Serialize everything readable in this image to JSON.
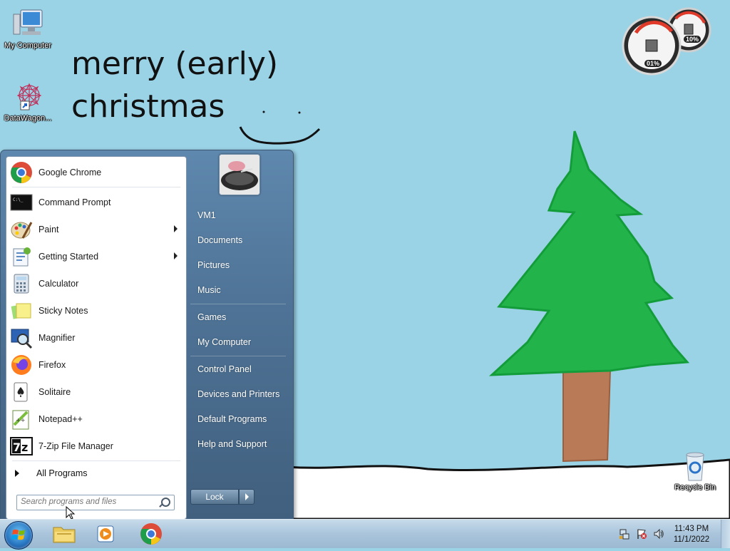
{
  "desktop": {
    "wallpaper_text_line1": "merry (early)",
    "wallpaper_text_line2": "christmas",
    "icons": [
      {
        "label": "My Computer",
        "icon": "my-computer-icon"
      },
      {
        "label": "DataWagon...",
        "icon": "datawagon-shortcut-icon"
      },
      {
        "label": "Recycle Bin",
        "icon": "recycle-bin-icon"
      }
    ]
  },
  "gadget": {
    "cpu_percent": "01%",
    "memory_percent": "10%"
  },
  "start_menu": {
    "programs": [
      {
        "label": "Google Chrome",
        "icon": "chrome-icon",
        "submenu": false
      },
      {
        "label": "Command Prompt",
        "icon": "command-prompt-icon",
        "submenu": false
      },
      {
        "label": "Paint",
        "icon": "paint-icon",
        "submenu": true
      },
      {
        "label": "Getting Started",
        "icon": "getting-started-icon",
        "submenu": true
      },
      {
        "label": "Calculator",
        "icon": "calculator-icon",
        "submenu": false
      },
      {
        "label": "Sticky Notes",
        "icon": "sticky-notes-icon",
        "submenu": false
      },
      {
        "label": "Magnifier",
        "icon": "magnifier-icon",
        "submenu": false
      },
      {
        "label": "Firefox",
        "icon": "firefox-icon",
        "submenu": false
      },
      {
        "label": "Solitaire",
        "icon": "solitaire-icon",
        "submenu": false
      },
      {
        "label": "Notepad++",
        "icon": "notepad-plus-plus-icon",
        "submenu": false
      },
      {
        "label": "7-Zip File Manager",
        "icon": "seven-zip-icon",
        "submenu": false
      }
    ],
    "all_programs": "All Programs",
    "search_placeholder": "Search programs and files",
    "right_items": [
      {
        "label": "VM1"
      },
      {
        "label": "Documents"
      },
      {
        "label": "Pictures"
      },
      {
        "label": "Music"
      },
      {
        "label": "Games"
      },
      {
        "label": "My Computer"
      },
      {
        "label": "Control Panel"
      },
      {
        "label": "Devices and Printers"
      },
      {
        "label": "Default Programs"
      },
      {
        "label": "Help and Support"
      }
    ],
    "lock_label": "Lock"
  },
  "taskbar": {
    "pinned": [
      {
        "icon": "file-explorer-icon"
      },
      {
        "icon": "media-player-icon"
      },
      {
        "icon": "chrome-icon"
      }
    ],
    "tray_icons": [
      "network-icon",
      "action-center-icon",
      "volume-icon"
    ],
    "time": "11:43 PM",
    "date": "11/1/2022"
  },
  "colors": {
    "sky": "#9bd3e6",
    "tree": "#22b44a",
    "trunk": "#b97a57",
    "snow": "#ffffff"
  }
}
